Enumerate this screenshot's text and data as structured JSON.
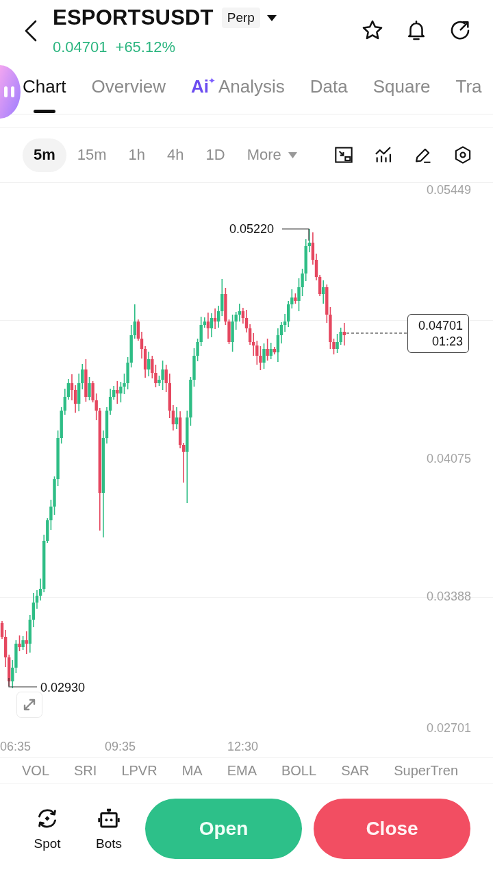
{
  "header": {
    "symbol": "ESPORTSUSDT",
    "contract_type": "Perp",
    "last_price": "0.04701",
    "change_percent": "+65.12%"
  },
  "tabs": [
    {
      "label": "Chart",
      "kind": "plain",
      "selected": true
    },
    {
      "label": "Overview",
      "kind": "plain",
      "selected": false
    },
    {
      "label": "Analysis",
      "kind": "ai",
      "badge": "Ai",
      "selected": false
    },
    {
      "label": "Data",
      "kind": "plain",
      "selected": false
    },
    {
      "label": "Square",
      "kind": "plain",
      "selected": false
    },
    {
      "label": "Tra",
      "kind": "plain",
      "selected": false
    }
  ],
  "timeframes": [
    {
      "label": "5m",
      "selected": true
    },
    {
      "label": "15m",
      "selected": false
    },
    {
      "label": "1h",
      "selected": false
    },
    {
      "label": "4h",
      "selected": false
    },
    {
      "label": "1D",
      "selected": false
    }
  ],
  "more_menu": {
    "label": "More"
  },
  "chart": {
    "price_axis": [
      "0.05449",
      "0.04075",
      "0.03388",
      "0.02701"
    ],
    "time_axis": [
      "06:35",
      "09:35",
      "12:30"
    ],
    "high_marker": "0.05220",
    "low_marker": "0.02930",
    "current_price": "0.04701",
    "countdown": "01:23"
  },
  "indicators": [
    "VOL",
    "SRI",
    "LPVR",
    "MA",
    "EMA",
    "BOLL",
    "SAR",
    "SuperTren"
  ],
  "bottom_bar": {
    "shortcuts": [
      {
        "label": "Spot",
        "kind": "spot"
      },
      {
        "label": "Bots",
        "kind": "bots"
      }
    ],
    "open_button": "Open",
    "close_button": "Close"
  }
}
